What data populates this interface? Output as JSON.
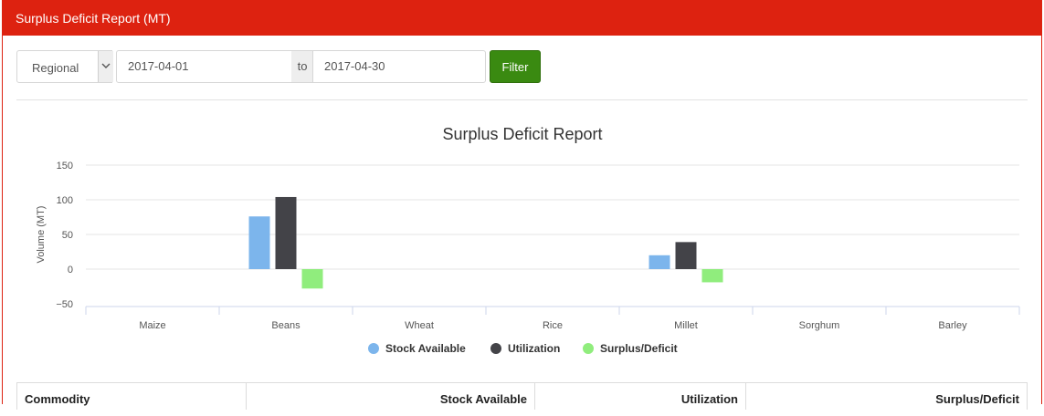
{
  "header": {
    "title": "Surplus Deficit Report (MT)"
  },
  "filter": {
    "level": "Regional",
    "date_from": "2017-04-01",
    "to_label": "to",
    "date_to": "2017-04-30",
    "button_label": "Filter"
  },
  "table": {
    "headers": [
      "Commodity",
      "Stock Available",
      "Utilization",
      "Surplus/Deficit"
    ]
  },
  "colors": {
    "header": "#dd2210",
    "button": "#3a8a11"
  },
  "chart_data": {
    "type": "bar",
    "title": "Surplus Deficit Report",
    "ylabel": "Volume (MT)",
    "xlabel": "",
    "categories": [
      "Maize",
      "Beans",
      "Wheat",
      "Rice",
      "Millet",
      "Sorghum",
      "Barley"
    ],
    "series": [
      {
        "name": "Stock Available",
        "color": "#7cb5ec",
        "values": [
          0,
          76,
          0,
          0,
          20,
          0,
          0
        ]
      },
      {
        "name": "Utilization",
        "color": "#434348",
        "values": [
          0,
          104,
          0,
          0,
          39,
          0,
          0
        ]
      },
      {
        "name": "Surplus/Deficit",
        "color": "#90ed7d",
        "values": [
          0,
          -28,
          0,
          0,
          -19,
          0,
          0
        ]
      }
    ],
    "ylim": [
      -50,
      150
    ],
    "yticks": [
      -50,
      0,
      50,
      100,
      150
    ],
    "grid": true,
    "legend": "bottom-center"
  }
}
